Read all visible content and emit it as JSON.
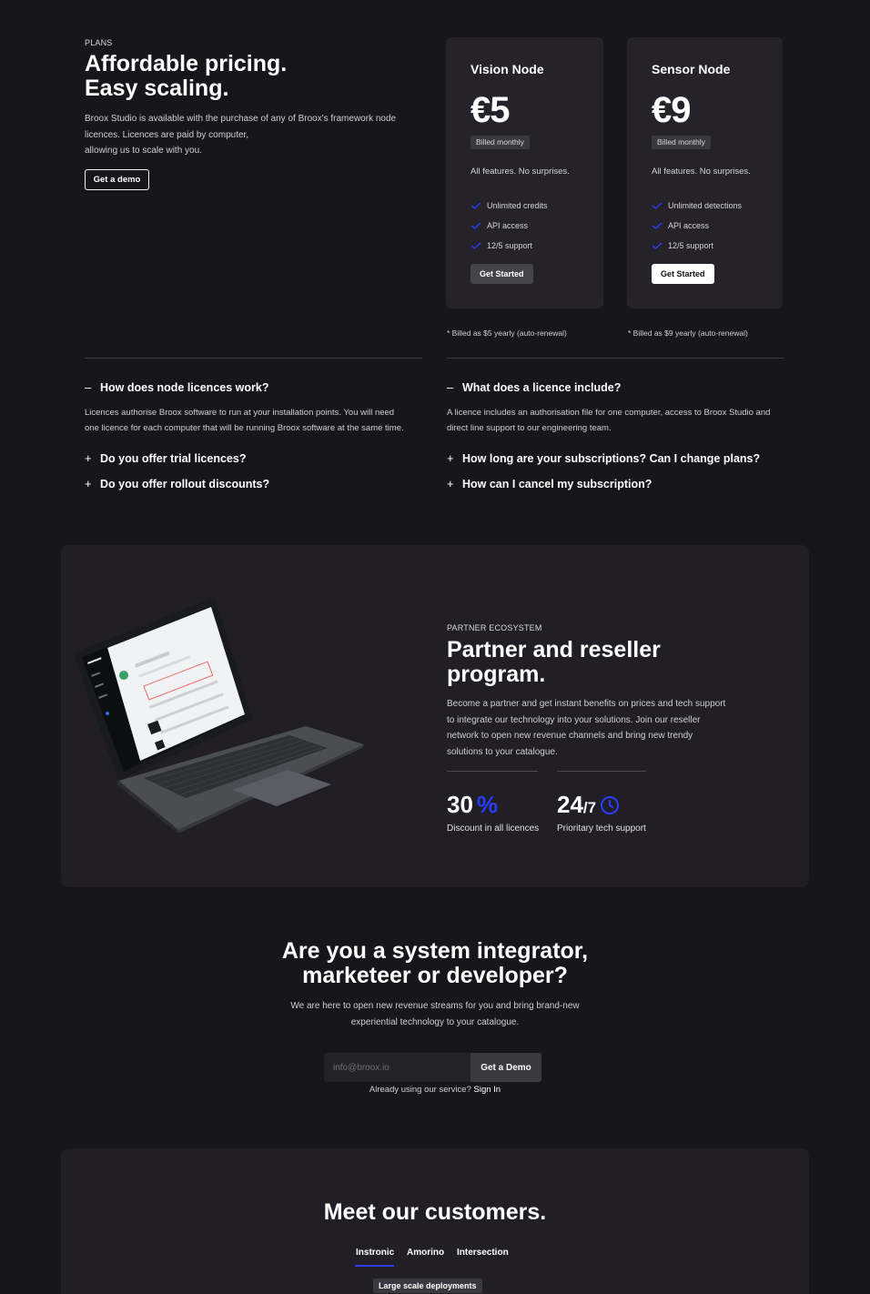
{
  "hero": {
    "eyebrow": "PLANS",
    "title_line1": "Affordable pricing.",
    "title_line2": "Easy scaling.",
    "body_line1": "Broox Studio is available with the purchase of any of Broox's framework node",
    "body_line2": "licences. Licences are paid by computer,",
    "body_line3": "allowing us to scale with you.",
    "cta_label": "Get a demo"
  },
  "plans": [
    {
      "name": "Vision Node",
      "price": "€5",
      "billed": "Billed monthly",
      "description": "All features. No surprises.",
      "features": [
        "Unlimited credits",
        "API access",
        "12/5 support"
      ],
      "button": "Get Started",
      "note": "* Billed as $5 yearly (auto-renewal)"
    },
    {
      "name": "Sensor Node",
      "price": "€9",
      "billed": "Billed monthly",
      "description": "All features. No surprises.",
      "features": [
        "Unlimited detections",
        "API access",
        "12/5 support"
      ],
      "button": "Get Started",
      "note": "* Billed as $9 yearly (auto-renewal)"
    }
  ],
  "faq": {
    "left": [
      {
        "question": "How does node licences work?",
        "expanded": true,
        "answer_line1": "Licences authorise Broox software to run at your installation points. You will need",
        "answer_line2": "one licence for each computer that will be running Broox software at the same time."
      },
      {
        "question": "Do you offer trial licences?",
        "expanded": false
      },
      {
        "question": "Do you offer rollout discounts?",
        "expanded": false
      }
    ],
    "right": [
      {
        "question": "What does a licence include?",
        "expanded": true,
        "answer_line1": "A licence includes an authorisation file for one computer, access to Broox Studio and",
        "answer_line2": "direct line support to our engineering team."
      },
      {
        "question": "How long are your subscriptions? Can I change plans?",
        "expanded": false
      },
      {
        "question": "How can I cancel my subscription?",
        "expanded": false
      }
    ],
    "signs": {
      "expanded": "–",
      "collapsed": "+"
    }
  },
  "partner": {
    "eyebrow": "PARTNER ECOSYSTEM",
    "title_line1": "Partner and reseller",
    "title_line2": "program.",
    "body_line1": "Become a partner and get instant benefits on prices and tech support",
    "body_line2": "to integrate our technology into your solutions. Join our reseller",
    "body_line3": "network to open new revenue channels and bring new trendy",
    "body_line4": "solutions to your catalogue.",
    "stats": [
      {
        "value": "30",
        "suffix": "%",
        "label": "Discount in all licences",
        "icon": "percent-icon"
      },
      {
        "value": "24",
        "suffix": "/7",
        "label": "Prioritary tech support",
        "icon": "clock-icon"
      }
    ],
    "accent_color": "#2a3cff"
  },
  "integrator": {
    "title_line1": "Are you a system integrator,",
    "title_line2": "marketeer or developer?",
    "body_line1": "We are here to open new revenue streams for you and bring brand-new",
    "body_line2": "experiential technology to your catalogue.",
    "email_placeholder": "info@broox.io",
    "button": "Get a Demo",
    "signin_prefix": "Already using our service?",
    "signin_link": "Sign In"
  },
  "customers": {
    "title": "Meet our customers.",
    "tabs": [
      "Instronic",
      "Amorino",
      "Intersection"
    ],
    "active_tab": 0,
    "badge": "Large scale deployments"
  },
  "colors": {
    "background": "#17161b",
    "card": "#252329",
    "section": "#211f25",
    "accent": "#2a3cff"
  }
}
